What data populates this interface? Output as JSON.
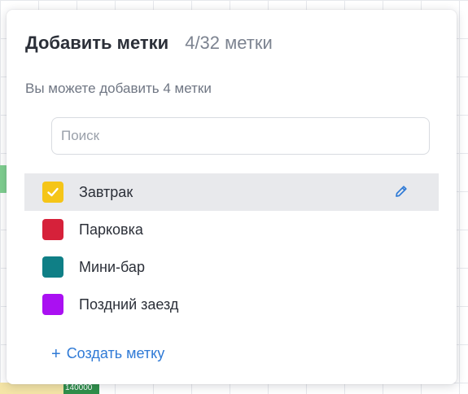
{
  "background": {
    "bottom_chip_text": "140000"
  },
  "dialog": {
    "title": "Добавить метки",
    "counter": "4/32 метки",
    "subtitle": "Вы можете добавить 4 метки"
  },
  "search": {
    "placeholder": "Поиск",
    "value": ""
  },
  "tags": [
    {
      "label": "Завтрак",
      "color": "#f5c518",
      "checked": true,
      "highlighted": true
    },
    {
      "label": "Парковка",
      "color": "#d6213a",
      "checked": false,
      "highlighted": false
    },
    {
      "label": "Мини-бар",
      "color": "#0f7f86",
      "checked": false,
      "highlighted": false
    },
    {
      "label": "Поздний заезд",
      "color": "#aa10f2",
      "checked": false,
      "highlighted": false
    }
  ],
  "actions": {
    "create_label": "Создать метку",
    "create_icon": "plus-icon",
    "edit_icon": "pencil-icon",
    "accent_color": "#2f7ad6"
  }
}
